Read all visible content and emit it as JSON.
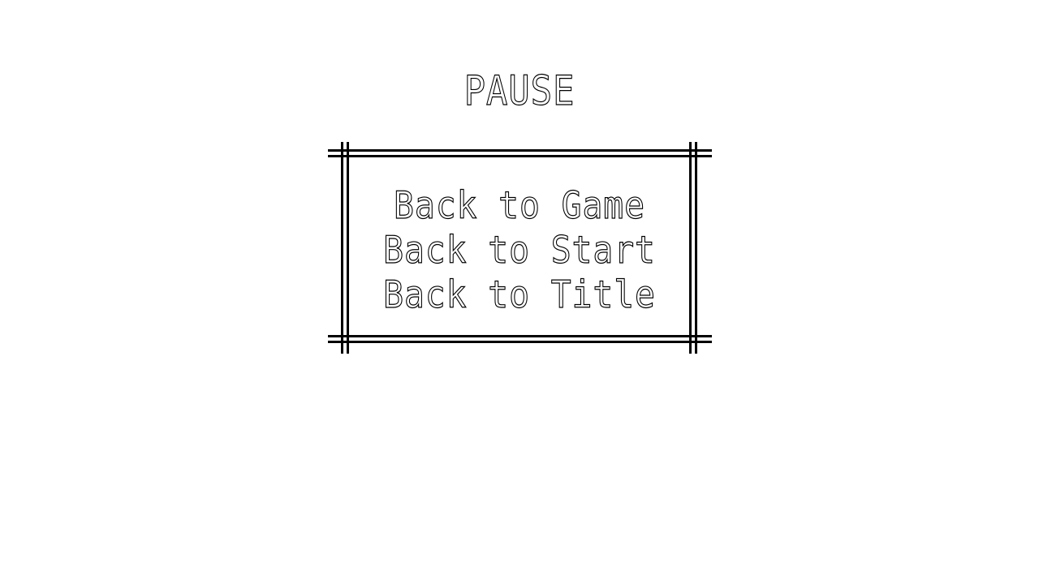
{
  "pause_menu": {
    "title": "PAUSE",
    "items": [
      {
        "label": "Back to Game"
      },
      {
        "label": "Back to Start"
      },
      {
        "label": "Back to Title"
      }
    ]
  },
  "colors": {
    "background": "#ffffff",
    "line": "#000000",
    "text_fill": "#ffffff",
    "text_outline": "#000000"
  }
}
